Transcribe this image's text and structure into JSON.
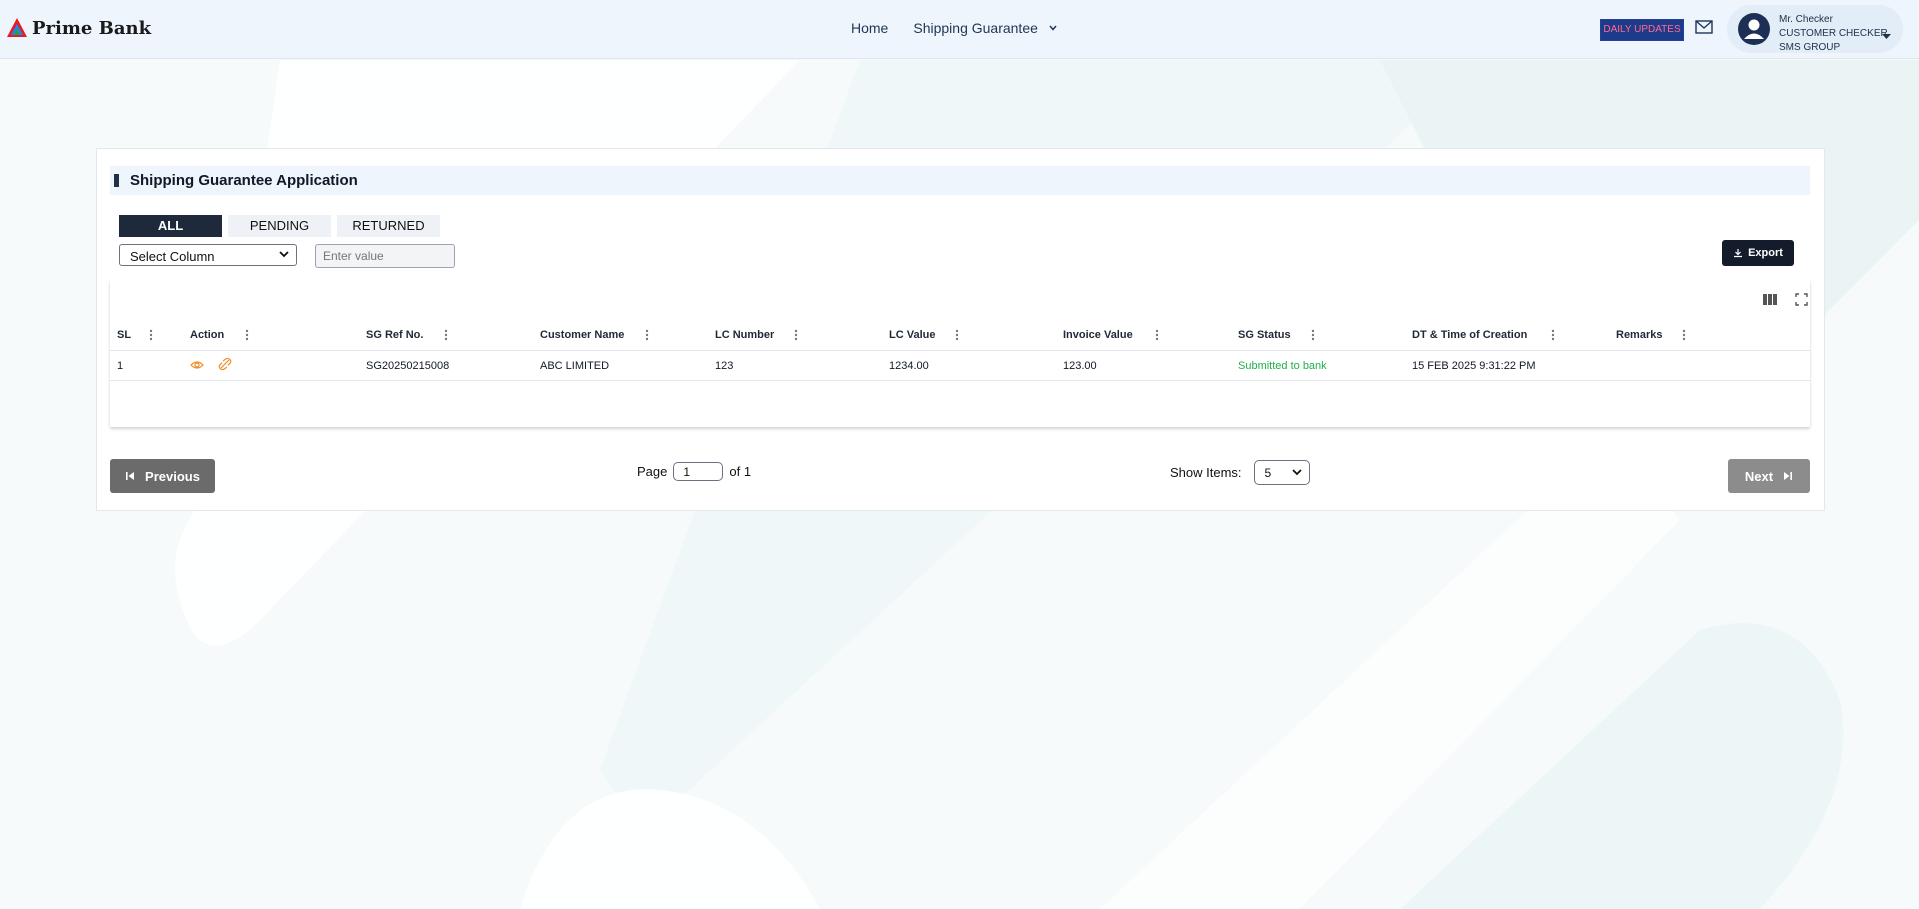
{
  "brand": {
    "name": "Prime Bank",
    "icon": "prime-bank-logo"
  },
  "nav": {
    "home": "Home",
    "shipping_guarantee": "Shipping Guarantee"
  },
  "header": {
    "daily_updates": "DAILY UPDATES",
    "user": {
      "name": "Mr. Checker",
      "role": "CUSTOMER CHECKER",
      "group": "SMS GROUP"
    }
  },
  "card": {
    "title": "Shipping Guarantee Application"
  },
  "tabs": [
    {
      "label": "ALL",
      "active": true
    },
    {
      "label": "PENDING",
      "active": false
    },
    {
      "label": "RETURNED",
      "active": false
    }
  ],
  "filter": {
    "column_select": "Select Column",
    "value_placeholder": "Enter value"
  },
  "export_label": "Export",
  "table": {
    "columns": [
      "SL",
      "Action",
      "SG Ref No.",
      "Customer Name",
      "LC Number",
      "LC Value",
      "Invoice Value",
      "SG Status",
      "DT & Time of Creation",
      "Remarks"
    ],
    "rows": [
      {
        "sl": "1",
        "sg_ref": "SG20250215008",
        "customer": "ABC LIMITED",
        "lc_number": "123",
        "lc_value": "1234.00",
        "invoice_value": "123.00",
        "status": "Submitted to bank",
        "created": "15 FEB 2025 9:31:22 PM",
        "remarks": ""
      }
    ]
  },
  "pagination": {
    "previous": "Previous",
    "next": "Next",
    "page_label": "Page",
    "page": "1",
    "of_label": "of 1",
    "show_items_label": "Show Items:",
    "show_items_value": "5"
  },
  "colors": {
    "accent": "#1e2a3b",
    "status_green": "#22b04b",
    "action_orange": "#f28c28"
  }
}
